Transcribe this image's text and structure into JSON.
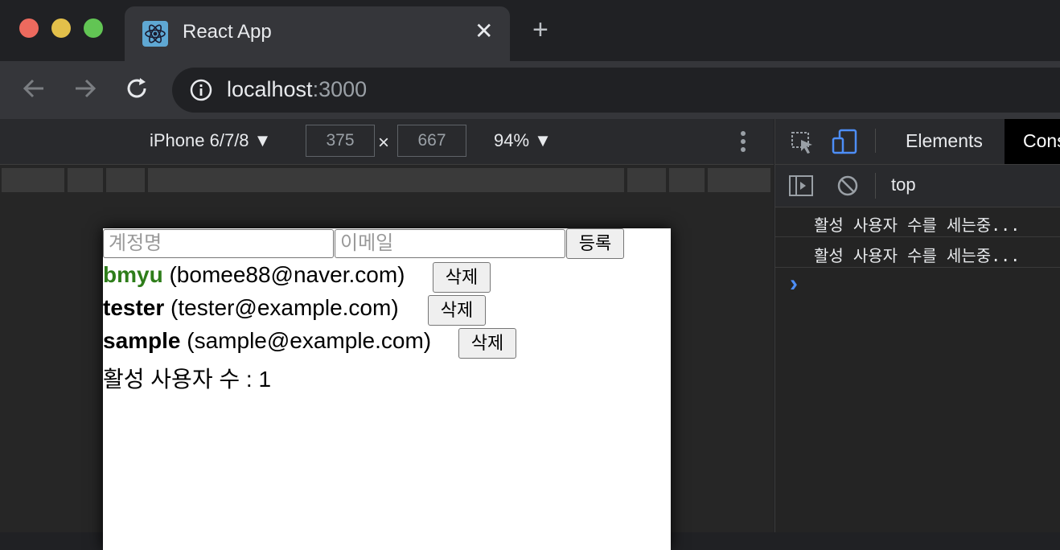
{
  "browser": {
    "tab_title": "React App",
    "tab_close": "✕",
    "new_tab": "+",
    "url_host": "localhost",
    "url_port": ":3000",
    "colors": {
      "close": "#ed6a5e",
      "minimize": "#e3c04a",
      "maximize": "#62c554"
    }
  },
  "device_toolbar": {
    "device": "iPhone 6/7/8",
    "width": "375",
    "times": "×",
    "height": "667",
    "zoom": "94%"
  },
  "app": {
    "username_placeholder": "계정명",
    "email_placeholder": "이메일",
    "register_label": "등록",
    "delete_label": "삭제",
    "users": [
      {
        "username": "bmyu",
        "email": "(bomee88@naver.com)",
        "active": true
      },
      {
        "username": "tester",
        "email": "(tester@example.com)",
        "active": false
      },
      {
        "username": "sample",
        "email": "(sample@example.com)",
        "active": false
      }
    ],
    "active_count_text": "활성 사용자 수 : 1",
    "active_color": "#2e7d1a"
  },
  "devtools": {
    "tab_elements": "Elements",
    "tab_console": "Cons",
    "context": "top",
    "logs": [
      "활성 사용자 수를 세는중...",
      "활성 사용자 수를 세는중..."
    ],
    "prompt": "›"
  }
}
